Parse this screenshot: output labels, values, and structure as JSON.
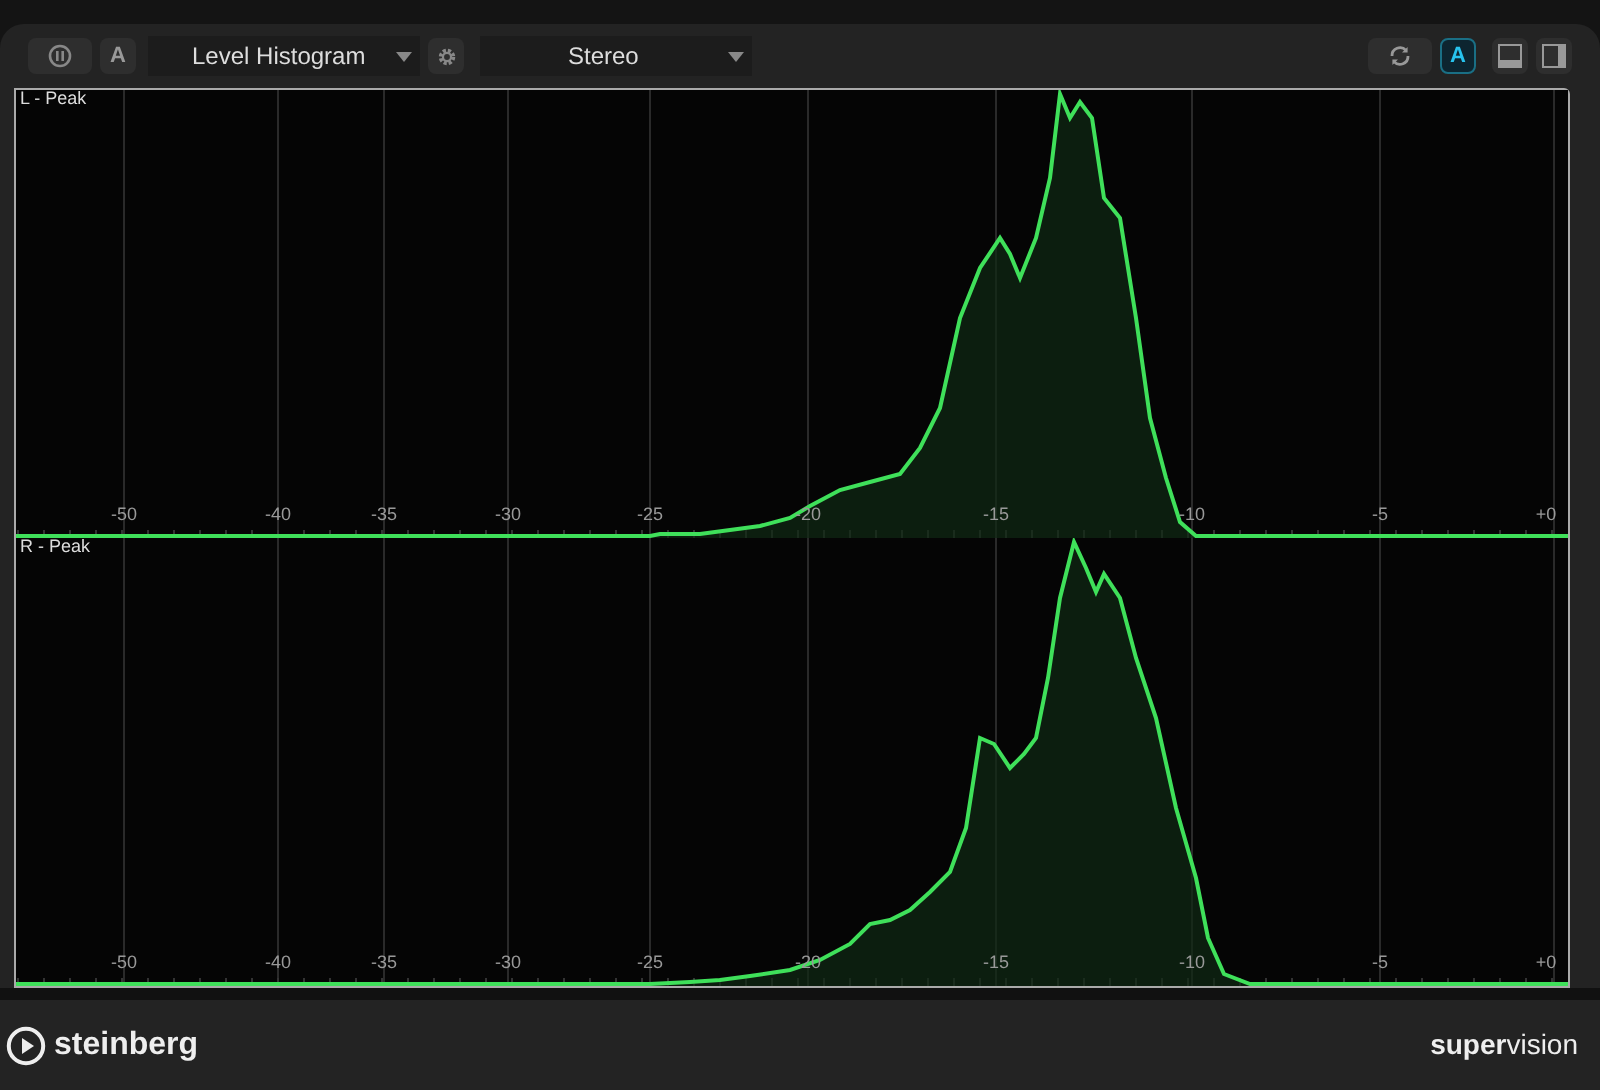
{
  "toolbar": {
    "auto_left": {
      "label": "A",
      "active": false
    },
    "view_select": {
      "value": "Level Histogram"
    },
    "channel_select": {
      "value": "Stereo"
    },
    "auto_right": {
      "label": "A",
      "active": true
    }
  },
  "plots": [
    {
      "label": "L - Peak",
      "ticks": [
        "-50",
        "-40",
        "-35",
        "-30",
        "-25",
        "-20",
        "-15",
        "-10",
        "-5",
        "+0"
      ]
    },
    {
      "label": "R - Peak",
      "ticks": [
        "-50",
        "-40",
        "-35",
        "-30",
        "-25",
        "-20",
        "-15",
        "-10",
        "-5",
        "+0"
      ]
    }
  ],
  "footer": {
    "brand": "steinberg",
    "product": "**super**vision"
  }
}
